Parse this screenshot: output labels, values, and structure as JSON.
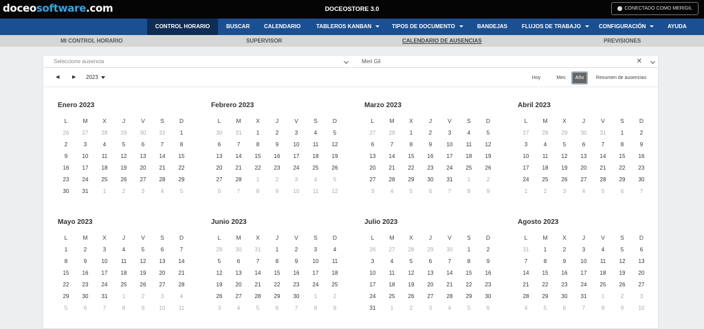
{
  "header": {
    "logo_part1": "doceo",
    "logo_part2": "software",
    "logo_part3": ".com",
    "store_name": "DOCEOSTORE 3.0",
    "connected": "CONECTADO COMO MERIGIL"
  },
  "main_nav": [
    "CONTROL HORARIO",
    "BUSCAR",
    "CALENDARIO",
    "TABLEROS KANBAN",
    "TIPOS DE DOCUMENTO",
    "BANDEJAS",
    "FLUJOS DE TRABAJO",
    "CONFIGURACIÓN",
    "AYUDA"
  ],
  "sub_nav": [
    "MI CONTROL HORARIO",
    "SUPERVISOR",
    "CALENDARIO DE AUSENCIAS",
    "PREVISIONES"
  ],
  "filters": {
    "absence_placeholder": "Seleccione ausencia",
    "user_value": "Meri Gil"
  },
  "toolbar": {
    "prev": "◀",
    "next": "▶",
    "year": "2023",
    "today": "Hoy",
    "month": "Mes",
    "year_view": "Año",
    "summary": "Resumen de ausencias"
  },
  "weekday_headers": [
    "L",
    "M",
    "X",
    "J",
    "V",
    "S",
    "D"
  ],
  "months": [
    {
      "title": "Enero 2023",
      "days": [
        "26",
        "27",
        "28",
        "29",
        "30",
        "31",
        "1",
        "2",
        "3",
        "4",
        "5",
        "6",
        "7",
        "8",
        "9",
        "10",
        "11",
        "12",
        "13",
        "14",
        "15",
        "16",
        "17",
        "18",
        "19",
        "20",
        "21",
        "22",
        "23",
        "24",
        "25",
        "26",
        "27",
        "28",
        "29",
        "30",
        "31",
        "1",
        "2",
        "3",
        "4",
        "5"
      ]
    },
    {
      "title": "Febrero 2023",
      "days": [
        "30",
        "31",
        "1",
        "2",
        "3",
        "4",
        "5",
        "6",
        "7",
        "8",
        "9",
        "10",
        "11",
        "12",
        "13",
        "14",
        "15",
        "16",
        "17",
        "18",
        "19",
        "20",
        "21",
        "22",
        "23",
        "24",
        "25",
        "26",
        "27",
        "28",
        "1",
        "2",
        "3",
        "4",
        "5",
        "6",
        "7",
        "8",
        "9",
        "10",
        "11",
        "12"
      ]
    },
    {
      "title": "Marzo 2023",
      "days": [
        "27",
        "28",
        "1",
        "2",
        "3",
        "4",
        "5",
        "6",
        "7",
        "8",
        "9",
        "10",
        "11",
        "12",
        "13",
        "14",
        "15",
        "16",
        "17",
        "18",
        "19",
        "20",
        "21",
        "22",
        "23",
        "24",
        "25",
        "26",
        "27",
        "28",
        "29",
        "30",
        "31",
        "1",
        "2",
        "3",
        "4",
        "5",
        "6",
        "7",
        "8",
        "9"
      ]
    },
    {
      "title": "Abril 2023",
      "days": [
        "27",
        "28",
        "29",
        "30",
        "31",
        "1",
        "2",
        "3",
        "4",
        "5",
        "6",
        "7",
        "8",
        "9",
        "10",
        "11",
        "12",
        "13",
        "14",
        "15",
        "16",
        "17",
        "18",
        "19",
        "20",
        "21",
        "22",
        "23",
        "24",
        "25",
        "26",
        "27",
        "28",
        "29",
        "30",
        "1",
        "2",
        "3",
        "4",
        "5",
        "6",
        "7"
      ]
    },
    {
      "title": "Mayo 2023",
      "days": [
        "1",
        "2",
        "3",
        "4",
        "5",
        "6",
        "7",
        "8",
        "9",
        "10",
        "11",
        "12",
        "13",
        "14",
        "15",
        "16",
        "17",
        "18",
        "19",
        "20",
        "21",
        "22",
        "23",
        "24",
        "25",
        "26",
        "27",
        "28",
        "29",
        "30",
        "31",
        "1",
        "2",
        "3",
        "4",
        "5",
        "6",
        "7",
        "8",
        "9",
        "10",
        "11"
      ]
    },
    {
      "title": "Junio 2023",
      "days": [
        "29",
        "30",
        "31",
        "1",
        "2",
        "3",
        "4",
        "5",
        "6",
        "7",
        "8",
        "9",
        "10",
        "11",
        "12",
        "13",
        "14",
        "15",
        "16",
        "17",
        "18",
        "19",
        "20",
        "21",
        "22",
        "23",
        "24",
        "25",
        "26",
        "27",
        "28",
        "29",
        "30",
        "1",
        "2",
        "3",
        "4",
        "5",
        "6",
        "7",
        "8",
        "9"
      ]
    },
    {
      "title": "Julio 2023",
      "days": [
        "26",
        "27",
        "28",
        "29",
        "30",
        "1",
        "2",
        "3",
        "4",
        "5",
        "6",
        "7",
        "8",
        "9",
        "10",
        "11",
        "12",
        "13",
        "14",
        "15",
        "16",
        "17",
        "18",
        "19",
        "20",
        "21",
        "22",
        "23",
        "24",
        "25",
        "26",
        "27",
        "28",
        "29",
        "30",
        "31",
        "1",
        "2",
        "3",
        "4",
        "5",
        "6"
      ]
    },
    {
      "title": "Agosto 2023",
      "days": [
        "31",
        "1",
        "2",
        "3",
        "4",
        "5",
        "6",
        "7",
        "8",
        "9",
        "10",
        "11",
        "12",
        "13",
        "14",
        "15",
        "16",
        "17",
        "18",
        "19",
        "20",
        "21",
        "22",
        "23",
        "24",
        "25",
        "26",
        "27",
        "28",
        "29",
        "30",
        "31",
        "1",
        "2",
        "3",
        "4",
        "5",
        "6",
        "7",
        "8",
        "9",
        "10"
      ]
    }
  ]
}
